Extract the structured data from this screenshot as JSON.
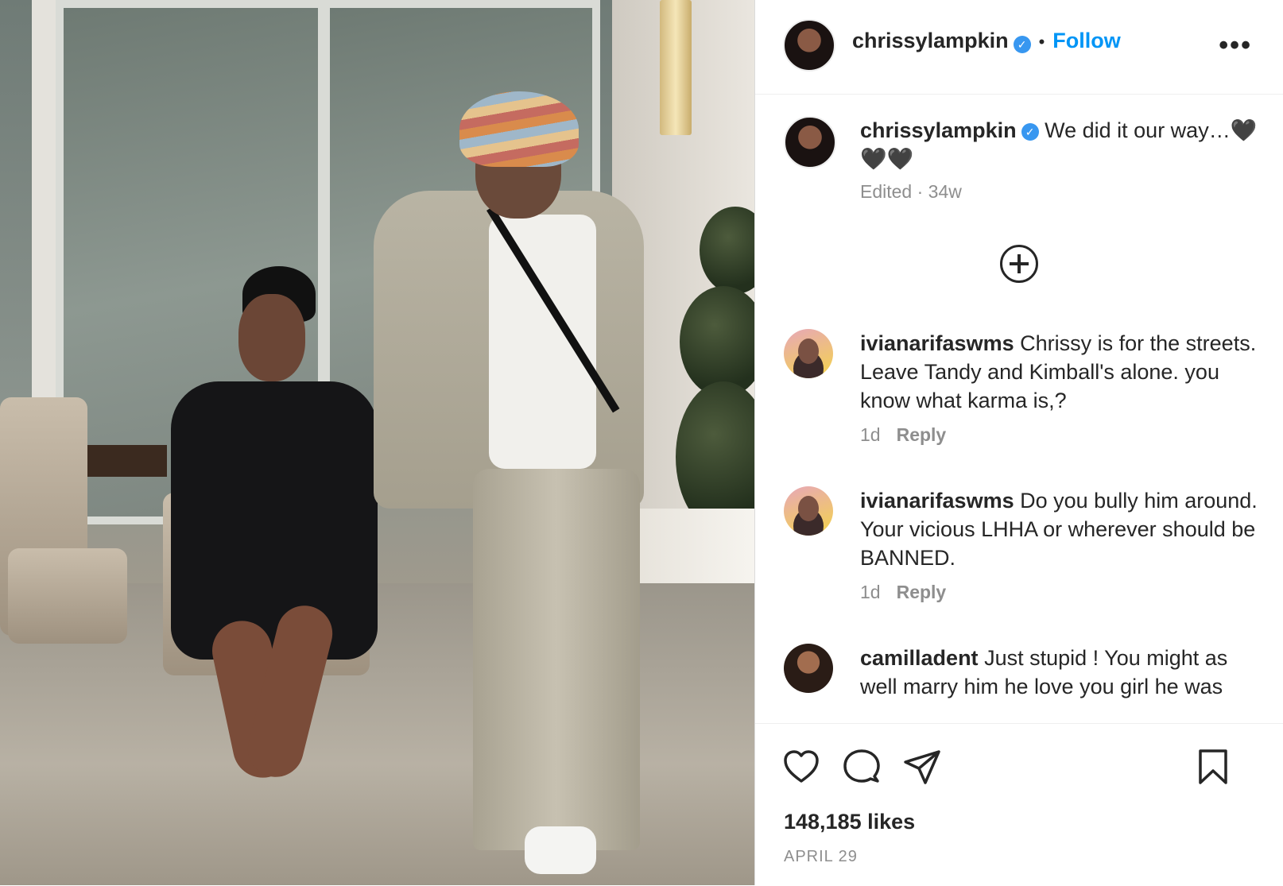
{
  "post": {
    "username": "chrissylampkin",
    "follow_label": "Follow",
    "more_label": "•••",
    "caption": "We did it our way…🖤🖤🖤",
    "caption_meta": "Edited · 34w",
    "likes": "148,185 likes",
    "date": "APRIL 29"
  },
  "comments": [
    {
      "username": "ivianarifaswms",
      "text": "Chrissy is for the streets. Leave Tandy and Kimball's alone. you know what karma is,?",
      "time": "1d",
      "reply": "Reply"
    },
    {
      "username": "ivianarifaswms",
      "text": "Do you bully him around. Your vicious LHHA or wherever should be BANNED.",
      "time": "1d",
      "reply": "Reply"
    },
    {
      "username": "camilladent",
      "text": "Just stupid ! You might as well marry him he love you girl he was",
      "time": "",
      "reply": ""
    }
  ],
  "icons": {
    "like": "heart-icon",
    "comment": "comment-icon",
    "share": "share-icon",
    "save": "bookmark-icon",
    "load_more": "plus-circle-icon",
    "verified": "verified-badge-icon"
  },
  "colors": {
    "link_blue": "#0095f6",
    "verified_blue": "#3897f0",
    "muted_text": "#8e8e8e"
  }
}
